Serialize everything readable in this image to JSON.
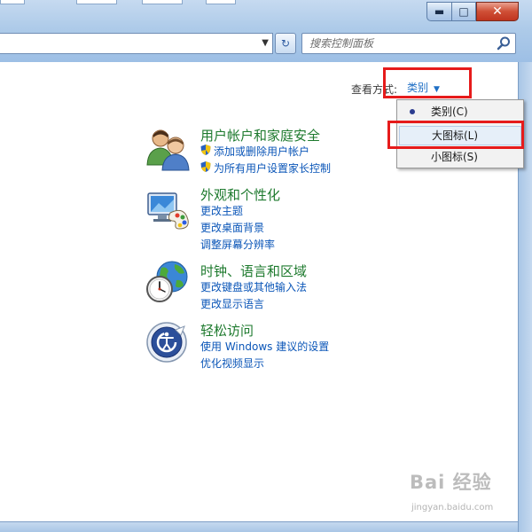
{
  "window": {
    "min_glyph": "▬",
    "max_glyph": "□",
    "close_glyph": "✕"
  },
  "toolbar": {
    "address_value": "",
    "refresh_glyph": "↻",
    "search": {
      "placeholder": "搜索控制面板"
    }
  },
  "view": {
    "label": "查看方式:",
    "current": "类别",
    "arrow_glyph": "▼",
    "menu": [
      {
        "label": "类别(C)",
        "selected": true
      },
      {
        "label": "大图标(L)",
        "selected": false
      },
      {
        "label": "小图标(S)",
        "selected": false
      }
    ]
  },
  "categories": [
    {
      "title": "用户帐户和家庭安全",
      "icon": "users-icon",
      "links": [
        {
          "text": "添加或删除用户帐户",
          "shield": true
        },
        {
          "text": "为所有用户设置家长控制",
          "shield": true
        }
      ]
    },
    {
      "title": "外观和个性化",
      "icon": "monitor-palette-icon",
      "links": [
        {
          "text": "更改主题",
          "shield": false
        },
        {
          "text": "更改桌面背景",
          "shield": false
        },
        {
          "text": "调整屏幕分辨率",
          "shield": false
        }
      ]
    },
    {
      "title": "时钟、语言和区域",
      "icon": "clock-globe-icon",
      "links": [
        {
          "text": "更改键盘或其他输入法",
          "shield": false
        },
        {
          "text": "更改显示语言",
          "shield": false
        }
      ]
    },
    {
      "title": "轻松访问",
      "icon": "ease-of-access-icon",
      "links": [
        {
          "text": "使用 Windows 建议的设置",
          "shield": false
        },
        {
          "text": "优化视频显示",
          "shield": false
        }
      ]
    }
  ],
  "watermark": {
    "logo": "Bai 经验",
    "url": "jingyan.baidu.com"
  },
  "colors": {
    "title_green": "#1e7a2e",
    "link_blue": "#0b56b8",
    "highlight_red": "#e61b1b"
  }
}
